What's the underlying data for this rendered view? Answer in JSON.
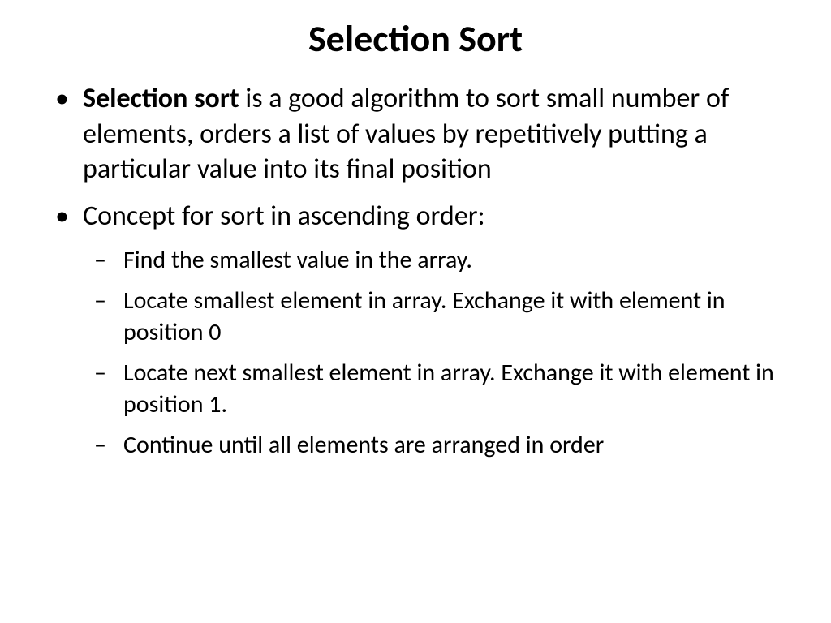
{
  "slide": {
    "title": "Selection Sort",
    "bullets": {
      "item1_bold": "Selection sort",
      "item1_rest": " is a good algorithm to sort small number of elements, orders a list of values by repetitively putting a particular value into its final position",
      "item2": "Concept for sort in ascending order:",
      "sub1": "Find the smallest value in the array.",
      "sub2": "Locate smallest element in array.  Exchange it with element in position 0",
      "sub3": "Locate next smallest element in array.  Exchange it with element in position 1.",
      "sub4": "Continue until all elements are arranged in order"
    }
  }
}
